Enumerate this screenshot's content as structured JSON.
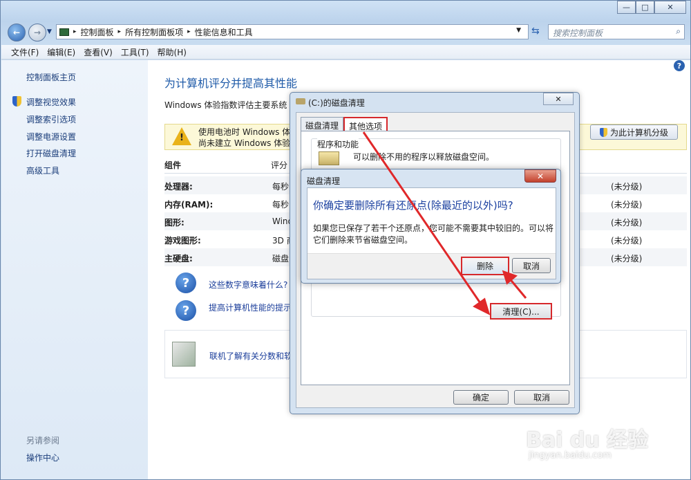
{
  "window": {
    "ghost_tabs": [
      "...",
      "...",
      "..."
    ],
    "caption_minimize": "—",
    "caption_maximize": "□",
    "caption_close": "✕"
  },
  "address": {
    "crumbs": [
      "控制面板",
      "所有控制面板项",
      "性能信息和工具"
    ],
    "separator": "▸"
  },
  "search": {
    "placeholder": "搜索控制面板"
  },
  "menu": [
    "文件(F)",
    "编辑(E)",
    "查看(V)",
    "工具(T)",
    "帮助(H)"
  ],
  "sidebar": {
    "home": "控制面板主页",
    "links": [
      "调整视觉效果",
      "调整索引选项",
      "调整电源设置",
      "打开磁盘清理",
      "高级工具"
    ],
    "see_also": "另请参阅",
    "action_center": "操作中心"
  },
  "main": {
    "title": "为计算机评分并提高其性能",
    "desc": "Windows 体验指数评估主要系统",
    "warning_line1": "使用电池时 Windows 体",
    "warning_line2": "尚未建立 Windows 体验",
    "rate_button": "为此计算机分级",
    "col_component": "组件",
    "col_rating": "评分",
    "rows": [
      {
        "label": "处理器:",
        "mid": "每秒",
        "val": "(未分级)"
      },
      {
        "label": "内存(RAM):",
        "mid": "每秒",
        "val": "(未分级)"
      },
      {
        "label": "图形:",
        "mid": "Wind",
        "val": "(未分级)"
      },
      {
        "label": "游戏图形:",
        "mid": "3D 商",
        "val": "(未分级)"
      },
      {
        "label": "主硬盘:",
        "mid": "磁盘",
        "val": "(未分级)"
      }
    ],
    "link1": "这些数字意味着什么?",
    "link2": "提高计算机性能的提示",
    "online": "联机了解有关分数和软"
  },
  "cleanup_dialog": {
    "title": "(C:)的磁盘清理",
    "close": "✕",
    "tabs": [
      "磁盘清理",
      "其他选项"
    ],
    "group_label": "程序和功能",
    "group_text": "可以删除不用的程序以释放磁盘空间。",
    "clean_button": "清理(C)...",
    "ok": "确定",
    "cancel": "取消"
  },
  "confirm_dialog": {
    "title": "磁盘清理",
    "close": "✕",
    "question": "你确定要删除所有还原点(除最近的以外)吗?",
    "message": "如果您已保存了若干个还原点，您可能不需要其中较旧的。可以将它们删除来节省磁盘空间。",
    "delete": "删除",
    "cancel": "取消"
  },
  "watermark": {
    "logo": "Bai du 经验",
    "url": "jingyan.baidu.com"
  },
  "colors": {
    "annotation_red": "#d6282b",
    "link_blue": "#1a3d9a",
    "title_blue": "#1e5aa8"
  }
}
